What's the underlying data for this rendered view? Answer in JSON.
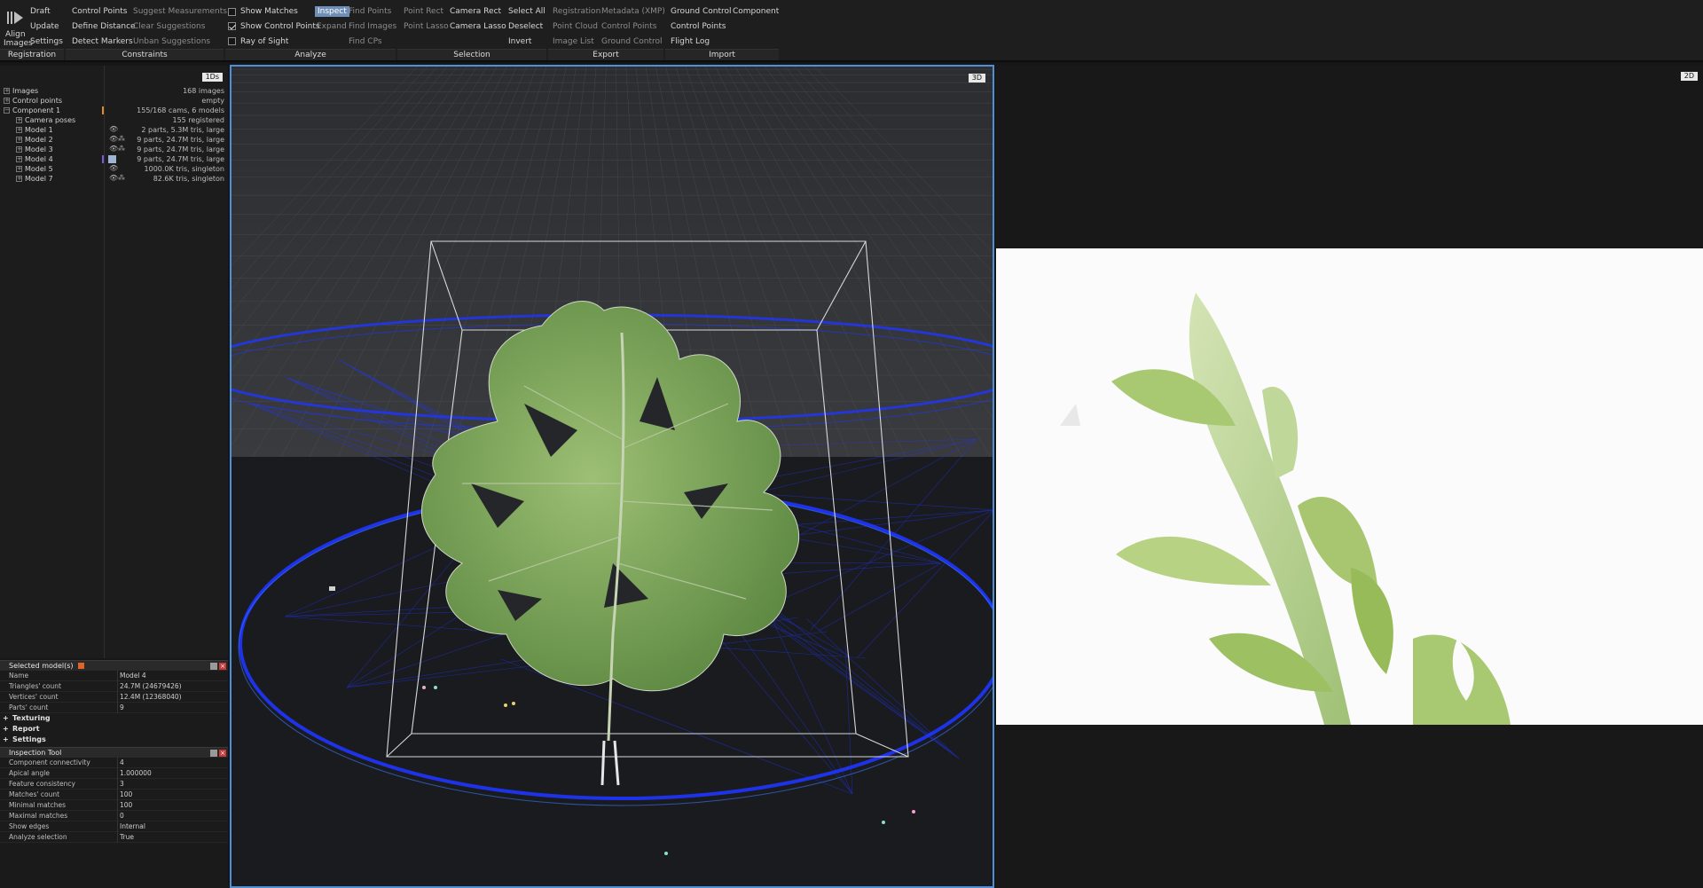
{
  "ribbon": {
    "align_images": [
      "Align",
      "Images"
    ],
    "registration": {
      "draft": "Draft",
      "update": "Update",
      "settings": "Settings",
      "label": "Registration"
    },
    "constraints": {
      "control_points": "Control Points",
      "suggest_measurements": "Suggest Measurements",
      "define_distance": "Define Distance",
      "clear_suggestions": "Clear Suggestions",
      "detect_markers": "Detect Markers",
      "unban_suggestions": "Unban Suggestions",
      "label": "Constraints"
    },
    "analyze": {
      "show_matches": "Show Matches",
      "show_control_points": "Show Control Points",
      "ray_of_sight": "Ray of Sight",
      "inspect": "Inspect",
      "expand": "Expand",
      "find_points": "Find Points",
      "find_images": "Find Images",
      "find_cps": "Find CPs",
      "label": "Analyze"
    },
    "selection": {
      "point_rect": "Point Rect",
      "point_lasso": "Point Lasso",
      "camera_rect": "Camera Rect",
      "camera_lasso": "Camera Lasso",
      "select_all": "Select All",
      "deselect": "Deselect",
      "invert": "Invert",
      "label": "Selection"
    },
    "export": {
      "registration": "Registration",
      "point_cloud": "Point Cloud",
      "image_list": "Image List",
      "metadata_xmp": "Metadata (XMP)",
      "control_points": "Control Points",
      "ground_control": "Ground Control",
      "label": "Export"
    },
    "import": {
      "ground_control": "Ground Control",
      "component": "Component",
      "control_points": "Control Points",
      "flight_log": "Flight Log",
      "label": "Import"
    }
  },
  "tree": {
    "tab_badge": "1Ds",
    "rows": [
      {
        "name": "Images",
        "value": "168 images"
      },
      {
        "name": "Control points",
        "value": "empty"
      },
      {
        "name": "Component 1",
        "value": "155/168 cams, 6 models"
      },
      {
        "name": "Camera poses",
        "value": "155 registered"
      },
      {
        "name": "Model 1",
        "value": "2 parts, 5.3M tris, large"
      },
      {
        "name": "Model 2",
        "value": "9 parts, 24.7M tris, large"
      },
      {
        "name": "Model 3",
        "value": "9 parts, 24.7M tris, large"
      },
      {
        "name": "Model 4",
        "value": "9 parts, 24.7M tris, large"
      },
      {
        "name": "Model 5",
        "value": "1000.0K tris, singleton"
      },
      {
        "name": "Model 7",
        "value": "82.6K tris, singleton"
      }
    ]
  },
  "selected_models": {
    "title": "Selected model(s)",
    "rows": [
      {
        "k": "Name",
        "v": "Model 4"
      },
      {
        "k": "Triangles' count",
        "v": "24.7M (24679426)"
      },
      {
        "k": "Vertices' count",
        "v": "12.4M (12368040)"
      },
      {
        "k": "Parts' count",
        "v": "9"
      }
    ],
    "sections": [
      "Texturing",
      "Report",
      "Settings"
    ]
  },
  "inspection_tool": {
    "title": "Inspection Tool",
    "rows": [
      {
        "k": "Component connectivity",
        "v": "4"
      },
      {
        "k": "Apical angle",
        "v": "1.000000"
      },
      {
        "k": "Feature consistency",
        "v": "3"
      },
      {
        "k": "Matches' count",
        "v": "100"
      },
      {
        "k": "Minimal matches",
        "v": "100"
      },
      {
        "k": "Maximal matches",
        "v": "0"
      },
      {
        "k": "Show edges",
        "v": "Internal"
      },
      {
        "k": "Analyze selection",
        "v": "True"
      }
    ]
  },
  "view3d": {
    "badge": "3D"
  },
  "view2d": {
    "badge": "2D"
  },
  "colors": {
    "accent": "#4f8fd6",
    "active_button": "#6f8fb8",
    "ray_blue": "#1f36ff",
    "leaf": "#7ea25a"
  }
}
